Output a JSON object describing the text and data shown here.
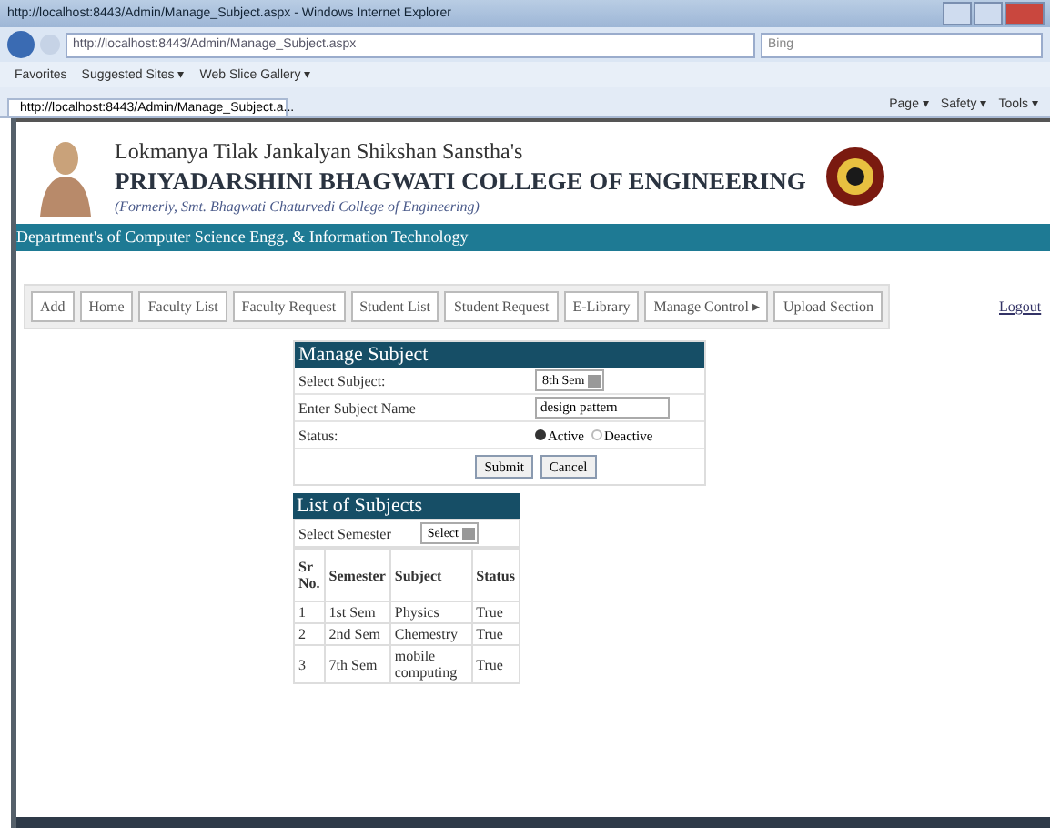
{
  "window": {
    "title": "http://localhost:8443/Admin/Manage_Subject.aspx - Windows Internet Explorer"
  },
  "address_bar": {
    "url": "http://localhost:8443/Admin/Manage_Subject.aspx",
    "search_placeholder": "Bing"
  },
  "favorites_bar": {
    "items": [
      {
        "label": "Favorites"
      },
      {
        "label": "Suggested Sites ▾"
      },
      {
        "label": "Web Slice Gallery ▾"
      }
    ]
  },
  "browser_tab": {
    "title": "http://localhost:8443/Admin/Manage_Subject.a...",
    "tools": [
      "Page ▾",
      "Safety ▾",
      "Tools ▾"
    ]
  },
  "header": {
    "trust": "Lokmanya Tilak Jankalyan Shikshan Sanstha's",
    "college": "PRIYADARSHINI BHAGWATI COLLEGE OF ENGINEERING",
    "formerly": "(Formerly, Smt. Bhagwati Chaturvedi College of Engineering)",
    "department": "Department's of Computer Science Engg. & Information Technology"
  },
  "nav": {
    "items": [
      {
        "label": "Add"
      },
      {
        "label": "Home"
      },
      {
        "label": "Faculty List"
      },
      {
        "label": "Faculty Request"
      },
      {
        "label": "Student List"
      },
      {
        "label": "Student Request"
      },
      {
        "label": "E-Library"
      },
      {
        "label": "Manage Control ▸"
      },
      {
        "label": "Upload Section"
      }
    ],
    "logout": "Logout"
  },
  "manage_subject": {
    "title": "Manage Subject",
    "select_label": "Select Subject:",
    "select_value": "8th Sem",
    "name_label": "Enter Subject Name",
    "name_value": "design pattern",
    "status_label": "Status:",
    "status_options": [
      {
        "label": "Active",
        "selected": true
      },
      {
        "label": "Deactive",
        "selected": false
      }
    ],
    "buttons": [
      "Submit",
      "Cancel"
    ]
  },
  "list": {
    "title": "List of Subjects",
    "semester_label": "Select Semester",
    "semester_value": "Select",
    "columns": [
      "Sr No.",
      "Semester",
      "Subject",
      "Status"
    ],
    "rows": [
      [
        "1",
        "1st Sem",
        "Physics",
        "True"
      ],
      [
        "2",
        "2nd Sem",
        "Chemestry",
        "True"
      ],
      [
        "3",
        "7th Sem",
        "mobile computing",
        "True"
      ]
    ]
  }
}
